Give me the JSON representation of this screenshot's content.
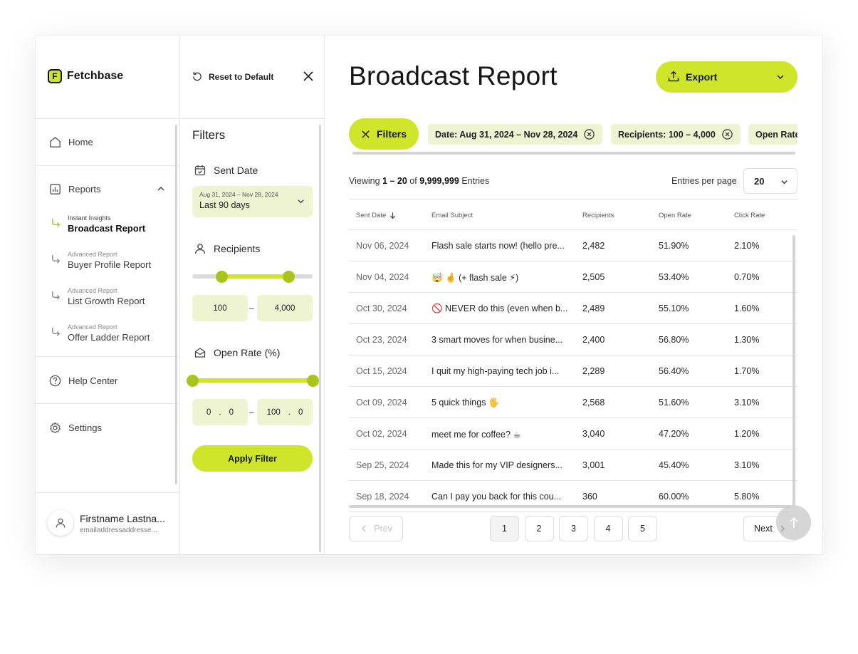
{
  "app": {
    "name": "Fetchbase",
    "logo_letter": "F"
  },
  "colors": {
    "accent": "#cfe52a",
    "accent_soft": "#eef3d2",
    "knob": "#a9c41c"
  },
  "sidebar": {
    "home": "Home",
    "reports": "Reports",
    "sub_items": [
      {
        "category": "Instant Insights",
        "name": "Broadcast Report",
        "active": true
      },
      {
        "category": "Advanced Report",
        "name": "Buyer Profile Report",
        "active": false
      },
      {
        "category": "Advanced Report",
        "name": "List Growth Report",
        "active": false
      },
      {
        "category": "Advanced Report",
        "name": "Offer Ladder Report",
        "active": false
      }
    ],
    "help": "Help Center",
    "settings": "Settings"
  },
  "user": {
    "name": "Firstname Lastna...",
    "email": "emailaddressaddresse..."
  },
  "filters": {
    "reset_label": "Reset to Default",
    "title": "Filters",
    "sent_date": {
      "label": "Sent Date",
      "range": "Aug 31, 2024 – Nov 28, 2024",
      "preset": "Last 90 days"
    },
    "recipients": {
      "label": "Recipients",
      "min": "100",
      "max": "4,000",
      "separator": "–",
      "slider_low": 0.24,
      "slider_high": 0.8
    },
    "open_rate": {
      "label": "Open Rate (%)",
      "min_int": "0",
      "min_dec": "0",
      "max_int": "100",
      "max_dec": "0",
      "dot": ".",
      "separator": "–",
      "slider_low": 0.0,
      "slider_high": 1.0
    },
    "apply_label": "Apply Filter"
  },
  "main": {
    "title": "Broadcast Report",
    "export_label": "Export",
    "filters_chip": "Filters",
    "chips": [
      "Date: Aug 31, 2024 – Nov 28, 2024",
      "Recipients: 100 – 4,000",
      "Open Rate"
    ],
    "viewing": {
      "prefix": "Viewing",
      "range": "1 – 20",
      "of": "of",
      "total": "9,999,999",
      "suffix": "Entries"
    },
    "entries_per_page_label": "Entries per page",
    "entries_per_page": "20"
  },
  "table": {
    "headers": [
      "Sent Date",
      "Email Subject",
      "Recipients",
      "Open Rate",
      "Click Rate"
    ],
    "rows": [
      [
        "Nov 06, 2024",
        "Flash sale starts now! (hello pre...",
        "2,482",
        "51.90%",
        "2.10%"
      ],
      [
        "Nov 04, 2024",
        "🤯 🤞 (+ flash sale ⚡)",
        "2,505",
        "53.40%",
        "0.70%"
      ],
      [
        "Oct 30, 2024",
        "🚫 NEVER do this (even when b...",
        "2,489",
        "55.10%",
        "1.60%"
      ],
      [
        "Oct 23, 2024",
        "3 smart moves for when busine...",
        "2,400",
        "56.80%",
        "1.30%"
      ],
      [
        "Oct 15, 2024",
        "I quit my high-paying tech job i...",
        "2,289",
        "56.40%",
        "1.70%"
      ],
      [
        "Oct 09, 2024",
        "5 quick things 🖐",
        "2,568",
        "51.60%",
        "3.10%"
      ],
      [
        "Oct 02, 2024",
        "meet me for coffee? ☕",
        "3,040",
        "47.20%",
        "1.20%"
      ],
      [
        "Sep 25, 2024",
        "Made this for my VIP designers...",
        "3,001",
        "45.40%",
        "3.10%"
      ],
      [
        "Sep 18, 2024",
        "Can I pay you back for this cou...",
        "360",
        "60.00%",
        "5.80%"
      ]
    ]
  },
  "pagination": {
    "prev": "Prev",
    "next": "Next",
    "pages": [
      "1",
      "2",
      "3",
      "4",
      "5"
    ],
    "current": "1"
  }
}
